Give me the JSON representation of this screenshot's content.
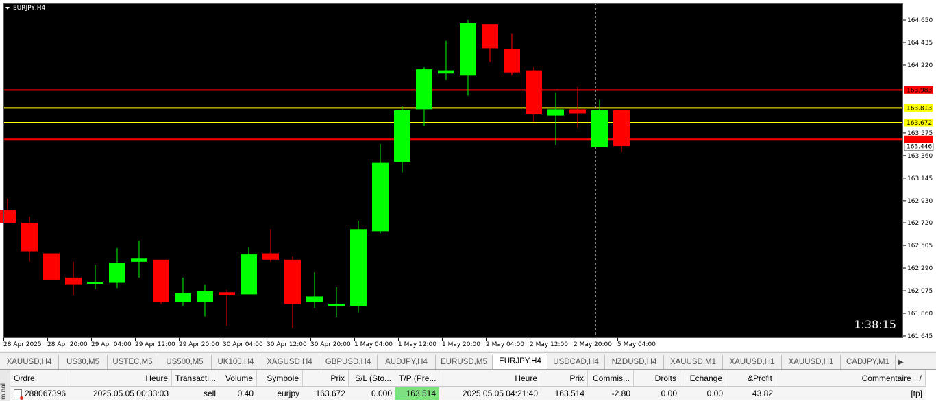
{
  "chart": {
    "title": "EURJPY,H4",
    "countdown": "1:38:15",
    "colors": {
      "background": "#000000",
      "bull": "#00ff00",
      "bear": "#ff0000",
      "level_red": "#ff0000",
      "level_yellow": "#ffff00",
      "crosshair": "#ffffff",
      "frame": "#000000"
    }
  },
  "chart_data": {
    "type": "candlestick",
    "title": "EURJPY,H4",
    "ylim": [
      161.645,
      164.725
    ],
    "y_ticks": [
      "164.650",
      "164.435",
      "164.220",
      "163.983",
      "163.813",
      "163.672",
      "163.575",
      "163.514",
      "163.446",
      "163.360",
      "163.145",
      "162.930",
      "162.720",
      "162.505",
      "162.290",
      "162.075",
      "161.860",
      "161.645"
    ],
    "axis_tick_labels": [
      "164.650",
      "164.435",
      "164.220",
      "163.575",
      "163.360",
      "163.145",
      "162.930",
      "162.720",
      "162.505",
      "162.290",
      "162.075",
      "161.860",
      "161.645"
    ],
    "x_labels": [
      "28 Apr 2025",
      "28 Apr 20:00",
      "29 Apr 04:00",
      "29 Apr 12:00",
      "29 Apr 20:00",
      "30 Apr 04:00",
      "30 Apr 12:00",
      "30 Apr 20:00",
      "1 May 04:00",
      "1 May 12:00",
      "1 May 20:00",
      "2 May 04:00",
      "2 May 12:00",
      "2 May 20:00",
      "5 May 04:00"
    ],
    "levels": [
      {
        "price": 163.983,
        "label": "163.983",
        "color": "#ff0000",
        "label_bg": "#ff0000",
        "label_fg": "#000000"
      },
      {
        "price": 163.813,
        "label": "163.813",
        "color": "#ffff00",
        "label_bg": "#ffff00",
        "label_fg": "#000000"
      },
      {
        "price": 163.672,
        "label": "163.672",
        "color": "#ffff00",
        "label_bg": "#ffff00",
        "label_fg": "#000000"
      },
      {
        "price": 163.514,
        "label": "163.514",
        "color": "#ff0000",
        "label_bg": "#ff0000",
        "label_fg": "#ff0000"
      },
      {
        "price": 163.446,
        "label": "163.446",
        "color": "none",
        "label_bg": "#ffffff",
        "label_fg": "#000000"
      }
    ],
    "candles": [
      {
        "o": 162.84,
        "h": 162.95,
        "l": 162.72,
        "c": 162.72
      },
      {
        "o": 162.72,
        "h": 162.78,
        "l": 162.35,
        "c": 162.45
      },
      {
        "o": 162.43,
        "h": 162.43,
        "l": 162.18,
        "c": 162.18
      },
      {
        "o": 162.2,
        "h": 162.35,
        "l": 162.03,
        "c": 162.13
      },
      {
        "o": 162.14,
        "h": 162.32,
        "l": 162.09,
        "c": 162.16
      },
      {
        "o": 162.15,
        "h": 162.48,
        "l": 162.1,
        "c": 162.34
      },
      {
        "o": 162.35,
        "h": 162.55,
        "l": 162.2,
        "c": 162.38
      },
      {
        "o": 162.37,
        "h": 162.37,
        "l": 161.95,
        "c": 161.97
      },
      {
        "o": 161.97,
        "h": 162.2,
        "l": 161.93,
        "c": 162.05
      },
      {
        "o": 161.97,
        "h": 162.13,
        "l": 161.83,
        "c": 162.07
      },
      {
        "o": 162.06,
        "h": 162.08,
        "l": 161.74,
        "c": 162.03
      },
      {
        "o": 162.04,
        "h": 162.49,
        "l": 162.04,
        "c": 162.42
      },
      {
        "o": 162.43,
        "h": 162.66,
        "l": 162.35,
        "c": 162.37
      },
      {
        "o": 162.37,
        "h": 162.4,
        "l": 161.72,
        "c": 161.95
      },
      {
        "o": 161.97,
        "h": 162.25,
        "l": 161.91,
        "c": 162.02
      },
      {
        "o": 161.93,
        "h": 162.11,
        "l": 161.82,
        "c": 161.95
      },
      {
        "o": 161.93,
        "h": 162.74,
        "l": 161.87,
        "c": 162.66
      },
      {
        "o": 162.64,
        "h": 163.47,
        "l": 162.62,
        "c": 163.29
      },
      {
        "o": 163.3,
        "h": 163.83,
        "l": 163.2,
        "c": 163.79
      },
      {
        "o": 163.8,
        "h": 164.2,
        "l": 163.64,
        "c": 164.18
      },
      {
        "o": 164.14,
        "h": 164.45,
        "l": 164.08,
        "c": 164.17
      },
      {
        "o": 164.12,
        "h": 164.65,
        "l": 163.93,
        "c": 164.62
      },
      {
        "o": 164.61,
        "h": 164.61,
        "l": 164.25,
        "c": 164.38
      },
      {
        "o": 164.37,
        "h": 164.52,
        "l": 164.12,
        "c": 164.15
      },
      {
        "o": 164.17,
        "h": 164.2,
        "l": 163.68,
        "c": 163.75
      },
      {
        "o": 163.74,
        "h": 163.96,
        "l": 163.46,
        "c": 163.8
      },
      {
        "o": 163.8,
        "h": 164.01,
        "l": 163.62,
        "c": 163.76
      },
      {
        "o": 163.44,
        "h": 163.89,
        "l": 163.44,
        "c": 163.79
      },
      {
        "o": 163.79,
        "h": 163.79,
        "l": 163.39,
        "c": 163.45
      }
    ]
  },
  "tabs": [
    {
      "label": "XAUUSD,H4",
      "active": false
    },
    {
      "label": "US30,M5",
      "active": false
    },
    {
      "label": "USTEC,M5",
      "active": false
    },
    {
      "label": "US500,M5",
      "active": false
    },
    {
      "label": "UK100,H4",
      "active": false
    },
    {
      "label": "XAGUSD,H4",
      "active": false
    },
    {
      "label": "GBPUSD,H4",
      "active": false
    },
    {
      "label": "AUDJPY,H4",
      "active": false
    },
    {
      "label": "EURUSD,M5",
      "active": false
    },
    {
      "label": "EURJPY,H4",
      "active": true
    },
    {
      "label": "USDCAD,H4",
      "active": false
    },
    {
      "label": "NZDUSD,H4",
      "active": false
    },
    {
      "label": "XAUUSD,M1",
      "active": false
    },
    {
      "label": "XAUUSD,H1",
      "active": false
    },
    {
      "label": "XAUUSD,H1",
      "active": false
    },
    {
      "label": "CADJPY,M1",
      "active": false
    }
  ],
  "tab_scroll": {
    "left": "◀",
    "right": "▶"
  },
  "terminal": {
    "side_label": "minal",
    "columns": [
      "Ordre",
      "Heure",
      "Transacti...",
      "Volume",
      "Symbole",
      "Prix",
      "S/L (Sto...",
      "T/P (Pre...",
      "Heure",
      "Prix",
      "Commis...",
      "Droits",
      "Echange",
      "&Profit",
      "Commentaire"
    ],
    "sort_marker": "/",
    "rows": [
      [
        "288067396",
        "2025.05.05 00:33:03",
        "sell",
        "0.40",
        "eurjpy",
        "163.672",
        "0.000",
        "163.514",
        "2025.05.05 04:21:40",
        "163.514",
        "-2.80",
        "0.00",
        "0.00",
        "43.82",
        "[tp]"
      ]
    ]
  }
}
